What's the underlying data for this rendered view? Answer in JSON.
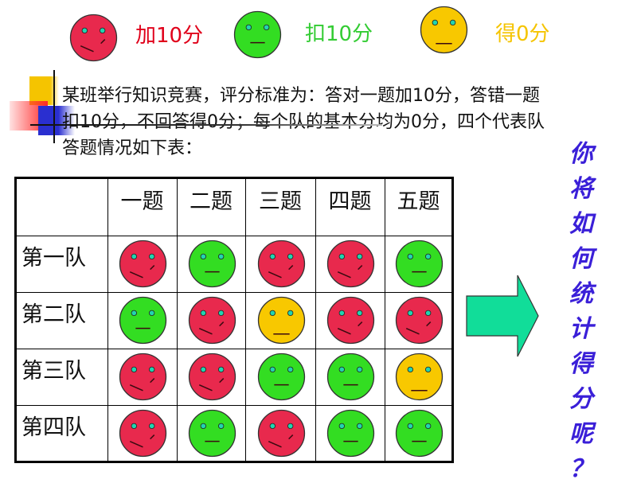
{
  "legend": [
    {
      "type": "red",
      "label": "加10分",
      "color": "#e0001a"
    },
    {
      "type": "green",
      "label": "扣10分",
      "color": "#33cc33"
    },
    {
      "type": "yellow",
      "label": "得0分",
      "color": "#f5c400"
    }
  ],
  "face_colors": {
    "red": "#e8294d",
    "green": "#33dd22",
    "yellow": "#f8c800",
    "eye": "#22d4b0"
  },
  "intro": {
    "lines": [
      "某班举行知识竞赛，评分标准为：答对一题加10分，答错一题",
      "扣10分，不回答得0分；每个队的基本分均为0分，四个代表队",
      "答题情况如下表："
    ]
  },
  "table": {
    "columns": [
      "一题",
      "二题",
      "三题",
      "四题",
      "五题"
    ],
    "rows": [
      {
        "team": "第一队",
        "answers": [
          "red",
          "green",
          "red",
          "red",
          "green"
        ]
      },
      {
        "team": "第二队",
        "answers": [
          "green",
          "red",
          "yellow",
          "red",
          "red"
        ]
      },
      {
        "team": "第三队",
        "answers": [
          "red",
          "red",
          "green",
          "green",
          "yellow"
        ]
      },
      {
        "team": "第四队",
        "answers": [
          "red",
          "green",
          "red",
          "green",
          "green"
        ]
      }
    ]
  },
  "arrow": {
    "color": "#11dd99",
    "icon": "right-arrow-icon"
  },
  "question": {
    "chars": [
      "你",
      "将",
      "如",
      "何",
      "统",
      "计",
      "得",
      "分",
      "呢",
      "？"
    ],
    "color": "#3a1fd8"
  }
}
